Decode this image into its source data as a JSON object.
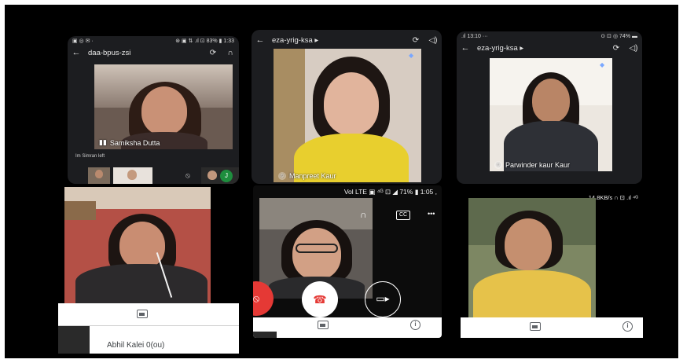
{
  "tiles": {
    "t1": {
      "status_left": "▣ ◎ ✉ ·",
      "status_right": "⊛ ▣ ⇅ .ıl ⊡ 83% ▮ 1:33",
      "meeting_code": "daa-bpus-zsi",
      "speaker_name": "Samiksha Dutta",
      "notice": "Im Simran left"
    },
    "t2": {
      "meeting_code": "eza-yrig-ksa ▸",
      "participant_name": "Manpreet Kaur"
    },
    "t3": {
      "status_left": ".ıl 13:10 ···",
      "status_right": "⊙ ⊡ ◎ 74% ▬",
      "meeting_code": "eza-yrig-ksa ▸",
      "participant_name": "Parwinder kaur Kaur"
    },
    "t4": {
      "participant_partial": "Abhil Kalei 0(ou)"
    },
    "t5": {
      "status_text": "Vol LTE ▣ ⁴ᴳ ⊡ ◢ 71% ▮ 1:05 ,",
      "cc_label": "CC",
      "more_label": "•••"
    },
    "t6": {
      "status_text": "14.8KB/s ∩ ⊡ .ıl ⁴ᴳ"
    }
  },
  "colors": {
    "background": "#000000",
    "end_call_red": "#e53935",
    "sheet_white": "#ffffff",
    "meet_dark": "#202124"
  }
}
